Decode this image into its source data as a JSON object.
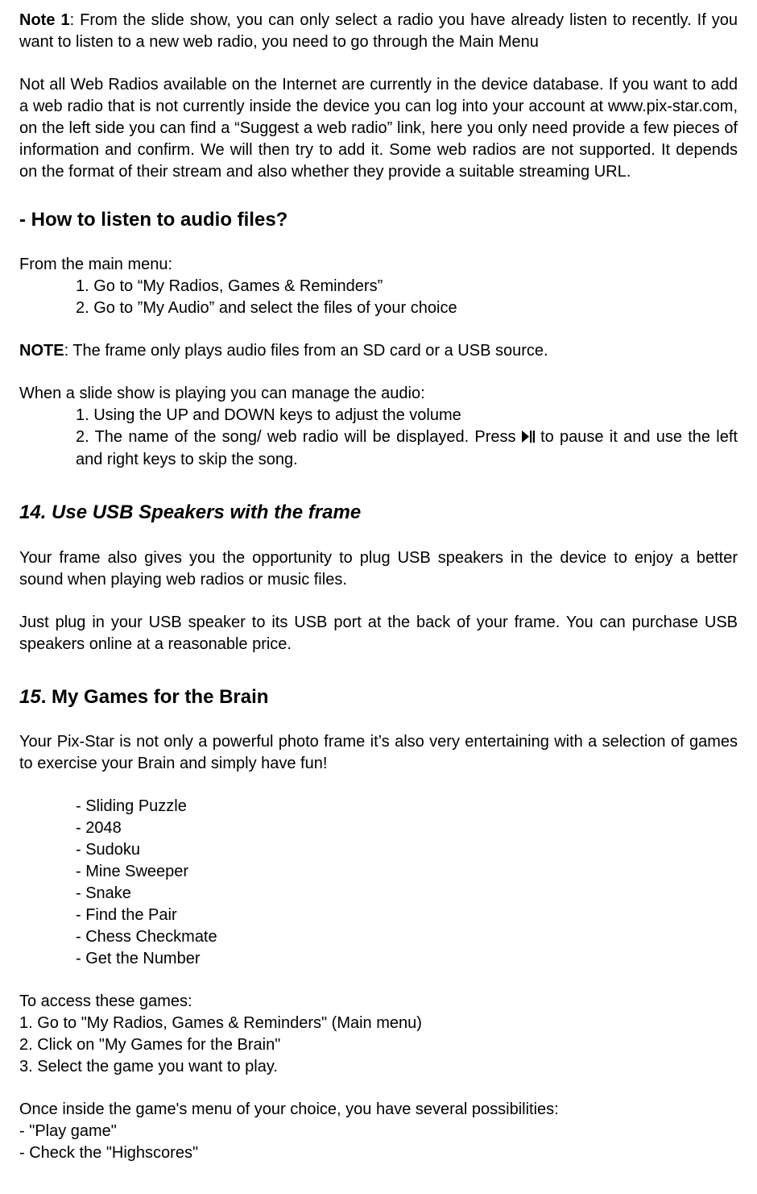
{
  "note1": {
    "label": "Note 1",
    "text": ": From the slide show, you can only select a radio you have already listen to recently. If you want to listen to a new web radio, you need to go through the Main Menu"
  },
  "para_webradio_db": "Not all Web Radios available on the Internet are currently in the device database. If you want to add a web radio that is not currently inside the device you can log into your account at www.pix-star.com, on the left side you can find a “Suggest a web radio” link, here you only need provide a few pieces of information and confirm. We will then try to add it. Some web radios are not supported. It depends on the format of their stream and also whether they provide a suitable streaming URL.",
  "heading_audio": "- How to listen to audio files?",
  "from_main_menu": "From the main menu:",
  "audio_steps": [
    "1. Go to “My Radios, Games & Reminders”",
    "2. Go to ”My Audio” and select the files of your choice"
  ],
  "note_label": "NOTE",
  "note_audio_source": ": The frame only plays audio files from an SD card or a USB source.",
  "manage_audio_intro": "When a slide show is playing you can manage the audio:",
  "manage_audio_steps": {
    "s1": "1. Using the UP and DOWN keys to adjust the volume",
    "s2a": "2. The name of the song/ web radio will be displayed. Press ",
    "s2b": " to pause it and use the left and right keys to skip the song."
  },
  "heading_usb": "14. Use USB Speakers with the frame",
  "usb_p1": "Your frame also gives you the opportunity to plug USB speakers in the device to enjoy a better sound when playing web radios or music files.",
  "usb_p2": "Just plug in your USB speaker to its USB port at the back of your frame. You can purchase USB speakers online at a reasonable price.",
  "heading_games_num": "15",
  "heading_games_text": ". My Games for the Brain",
  "games_intro": "Your Pix-Star is not only a powerful photo frame it’s also very entertaining with a selection of games to exercise your Brain and simply have fun!",
  "games": [
    "- Sliding Puzzle",
    "- 2048",
    "- Sudoku",
    "- Mine Sweeper",
    "- Snake",
    "- Find the Pair",
    "- Chess Checkmate",
    "- Get the Number"
  ],
  "access_games_intro": "To access these games:",
  "access_games_steps": [
    "1. Go to \"My Radios, Games & Reminders\" (Main menu)",
    "2. Click on \"My Games for the Brain\"",
    "3. Select the game you want to play."
  ],
  "inside_game_intro": "Once inside the game's menu of your choice, you have several possibilities:",
  "inside_game_options": [
    "- \"Play game\"",
    "- Check the \"Highscores\""
  ]
}
